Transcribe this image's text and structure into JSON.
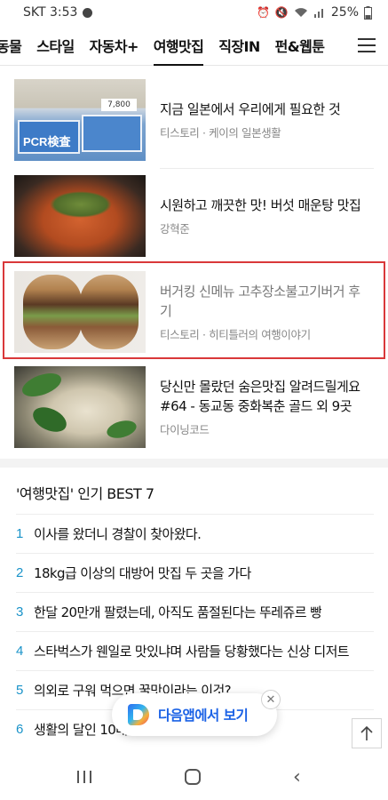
{
  "status_bar": {
    "carrier_time": "SKT 3:53",
    "battery": "25%"
  },
  "category_nav": {
    "tabs": [
      {
        "label": "동물",
        "active": false
      },
      {
        "label": "스타일",
        "active": false
      },
      {
        "label": "자동차+",
        "active": false
      },
      {
        "label": "여행맛집",
        "active": true
      },
      {
        "label": "직장IN",
        "active": false
      },
      {
        "label": "펀&웹툰",
        "active": false
      }
    ],
    "menu_icon": "hamburger-menu-icon"
  },
  "articles": [
    {
      "title": "지금 일본에서 우리에게 필요한 것",
      "source": "티스토리 · 케이의 일본생활",
      "thumb": "pcr-test-kits",
      "thumb_text": "PCR検査",
      "thumb_price": "7,800"
    },
    {
      "title": "시원하고 깨끗한 맛! 버섯 매운탕 맛집",
      "source": "강혁준",
      "thumb": "mushroom-stew"
    },
    {
      "title": "버거킹 신메뉴 고추장소불고기버거 후기",
      "source": "티스토리 · 히티틀러의 여행이야기",
      "thumb": "burger-halves",
      "highlighted": true
    },
    {
      "title": "당신만 몰랐던 숨은맛집 알려드릴게요 #64 - 동교동 중화복춘 골드 외 9곳",
      "source": "다이닝코드",
      "thumb": "seafood-hotpot"
    }
  ],
  "best": {
    "title": "'여행맛집' 인기 BEST 7",
    "items": [
      {
        "rank": "1",
        "title": "이사를 왔더니 경찰이 찾아왔다."
      },
      {
        "rank": "2",
        "title": "18kg급 이상의 대방어 맛집 두 곳을 가다"
      },
      {
        "rank": "3",
        "title": "한달 20만개 팔렸는데, 아직도 품절된다는 뚜레쥬르 빵"
      },
      {
        "rank": "4",
        "title": "스타벅스가 웬일로 맛있냐며 사람들 당황했다는 신상 디저트"
      },
      {
        "rank": "5",
        "title": "의외로 구워 먹으면 꿀맛이라는 이것?"
      },
      {
        "rank": "6",
        "title": "생활의 달인 10대 맛집 리스트"
      }
    ]
  },
  "app_banner": {
    "label": "다음앱에서 보기",
    "close_glyph": "✕"
  },
  "colors": {
    "highlight_border": "#d9383a",
    "rank_number": "#1a93c9",
    "app_banner_text": "#1b62e6"
  }
}
